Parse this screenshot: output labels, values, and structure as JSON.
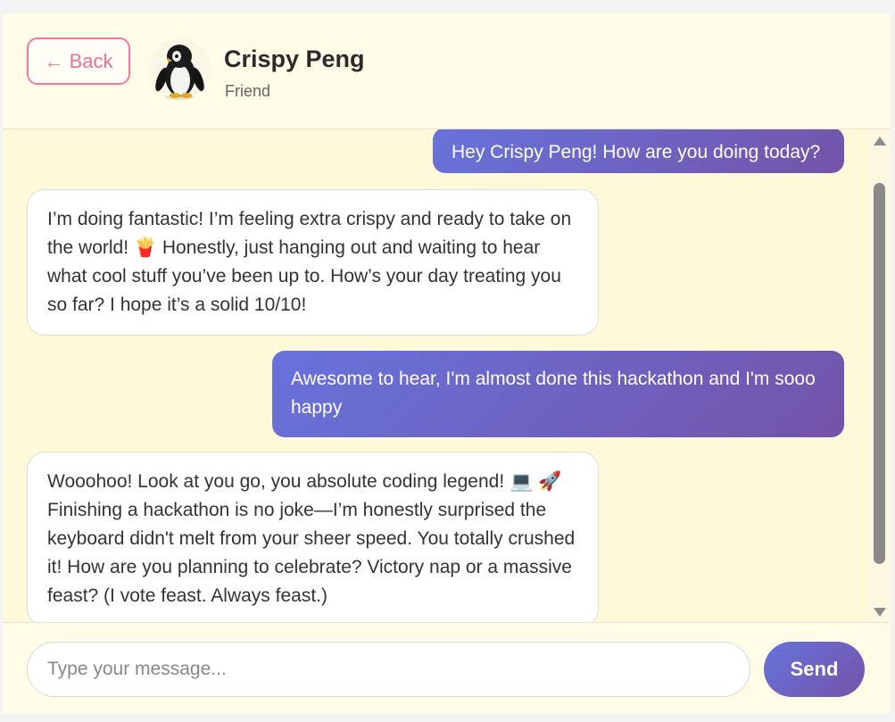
{
  "header": {
    "back_label": "← Back",
    "contact_name": "Crispy Peng",
    "contact_role": "Friend",
    "avatar_icon": "penguin-icon"
  },
  "messages": [
    {
      "sender": "user",
      "text": "Hey Crispy Peng! How are you doing today?"
    },
    {
      "sender": "bot",
      "text": "I’m doing fantastic! I’m feeling extra crispy and ready to take on the world! 🍟 Honestly, just hanging out and waiting to hear what cool stuff you’ve been up to. How’s your day treating you so far? I hope it’s a solid 10/10!"
    },
    {
      "sender": "user",
      "text": "Awesome to hear, I'm almost done this hackathon and I'm sooo happy"
    },
    {
      "sender": "bot",
      "text": "Wooohoo! Look at you go, you absolute coding legend! 💻 🚀 Finishing a hackathon is no joke—I’m honestly surprised the keyboard didn't melt from your sheer speed. You totally crushed it! How are you planning to celebrate? Victory nap or a massive feast? (I vote feast. Always feast.)"
    }
  ],
  "composer": {
    "placeholder": "Type your message...",
    "value": "",
    "send_label": "Send"
  },
  "colors": {
    "accent_gradient_start": "#6773dc",
    "accent_gradient_end": "#7453a8",
    "back_button": "#ef6f94",
    "chat_background": "#fef9d8"
  }
}
